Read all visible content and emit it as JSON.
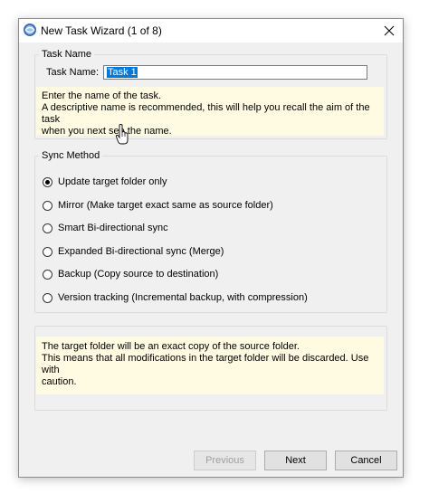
{
  "window": {
    "title": "New Task Wizard (1 of 8)"
  },
  "task_name": {
    "group_title": "Task Name",
    "label": "Task Name:",
    "value": "Task 1",
    "hint_line1": "Enter the name of the task.",
    "hint_line2": "A descriptive name is recommended, this will help you recall the aim of the task",
    "hint_line3": "when you next see the name."
  },
  "sync_method": {
    "group_title": "Sync Method",
    "selected": "Update target folder only",
    "options": [
      {
        "label": "Update target folder only",
        "checked": true
      },
      {
        "label": "Mirror (Make target exact same as source folder)",
        "checked": false
      },
      {
        "label": "Smart Bi-directional sync",
        "checked": false
      },
      {
        "label": "Expanded Bi-directional sync (Merge)",
        "checked": false
      },
      {
        "label": "Backup (Copy source to destination)",
        "checked": false
      },
      {
        "label": "Version tracking (Incremental backup, with compression)",
        "checked": false
      }
    ]
  },
  "description": {
    "line1": "The target folder will be an exact copy of the source folder.",
    "line2": "This means that all modifications in the target folder will be discarded. Use with",
    "line3": "caution."
  },
  "buttons": {
    "previous": "Previous",
    "next": "Next",
    "cancel": "Cancel",
    "previous_enabled": false
  },
  "icons": {
    "app": "globe-sync-icon",
    "close": "close-icon",
    "cursor": "hand-pointer-icon"
  }
}
